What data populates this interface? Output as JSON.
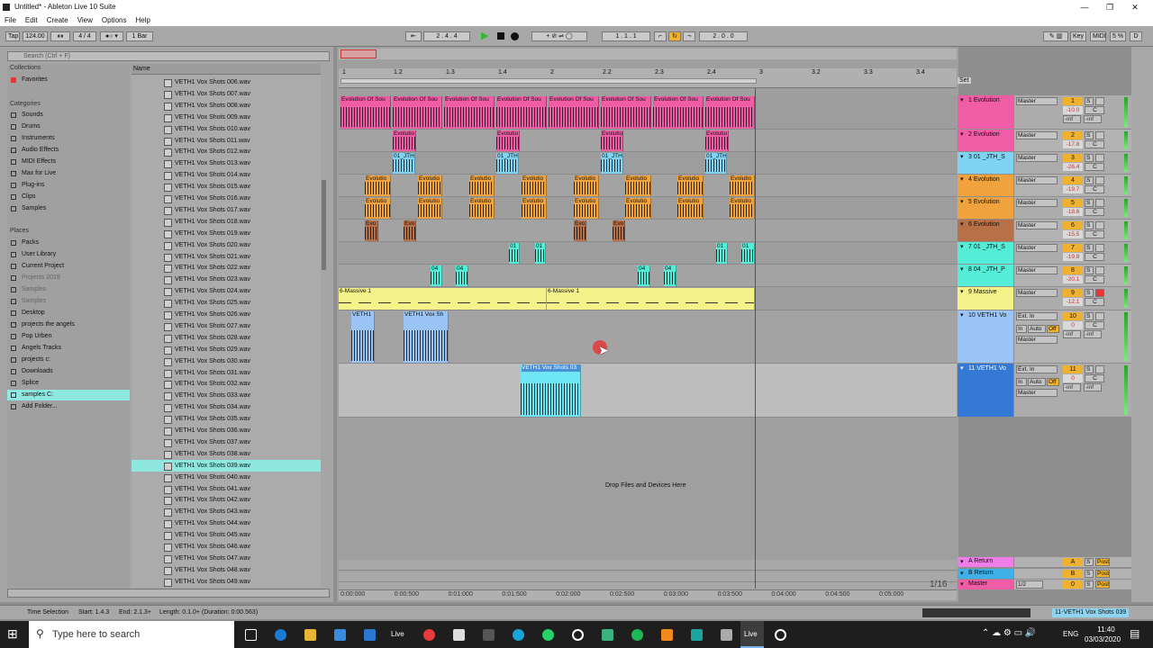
{
  "window": {
    "title": "Untitled* - Ableton Live 10 Suite",
    "controls": [
      "—",
      "❐",
      "✕"
    ]
  },
  "menu": [
    "File",
    "Edit",
    "Create",
    "View",
    "Options",
    "Help"
  ],
  "transport": {
    "tap": "Tap",
    "tempo": "124.00",
    "signature": "4 / 4",
    "quantize": "1 Bar",
    "arrangement_position": "2 . 4 . 4",
    "loop_start": "1 . 1 . 1",
    "loop_length": "2 . 0 . 0",
    "key": "Key",
    "midi": "MIDI",
    "cpu": "5 %",
    "d": "D"
  },
  "browser": {
    "search_placeholder": "Search (Ctrl + F)",
    "collections_title": "Collections",
    "favorites": "Favorites",
    "categories_title": "Categories",
    "categories": [
      "Sounds",
      "Drums",
      "Instruments",
      "Audio Effects",
      "MIDI Effects",
      "Max for Live",
      "Plug-ins",
      "Clips",
      "Samples"
    ],
    "places_title": "Places",
    "places": [
      "Packs",
      "User Library",
      "Current Project",
      "Projects 2019",
      "Samples",
      "Samples",
      "Desktop",
      "projects the angels",
      "Pop Urben",
      "Angels Tracks",
      "projects c:",
      "Downloads",
      "Splice",
      "samples C:",
      "Add Folder..."
    ],
    "name_header": "Name",
    "files": [
      "VETH1 Vox Shots 006.wav",
      "VETH1 Vox Shots 007.wav",
      "VETH1 Vox Shots 008.wav",
      "VETH1 Vox Shots 009.wav",
      "VETH1 Vox Shots 010.wav",
      "VETH1 Vox Shots 011.wav",
      "VETH1 Vox Shots 012.wav",
      "VETH1 Vox Shots 013.wav",
      "VETH1 Vox Shots 014.wav",
      "VETH1 Vox Shots 015.wav",
      "VETH1 Vox Shots 016.wav",
      "VETH1 Vox Shots 017.wav",
      "VETH1 Vox Shots 018.wav",
      "VETH1 Vox Shots 019.wav",
      "VETH1 Vox Shots 020.wav",
      "VETH1 Vox Shots 021.wav",
      "VETH1 Vox Shots 022.wav",
      "VETH1 Vox Shots 023.wav",
      "VETH1 Vox Shots 024.wav",
      "VETH1 Vox Shots 025.wav",
      "VETH1 Vox Shots 026.wav",
      "VETH1 Vox Shots 027.wav",
      "VETH1 Vox Shots 028.wav",
      "VETH1 Vox Shots 029.wav",
      "VETH1 Vox Shots 030.wav",
      "VETH1 Vox Shots 031.wav",
      "VETH1 Vox Shots 032.wav",
      "VETH1 Vox Shots 033.wav",
      "VETH1 Vox Shots 034.wav",
      "VETH1 Vox Shots 035.wav",
      "VETH1 Vox Shots 036.wav",
      "VETH1 Vox Shots 037.wav",
      "VETH1 Vox Shots 038.wav",
      "VETH1 Vox Shots 039.wav",
      "VETH1 Vox Shots 040.wav",
      "VETH1 Vox Shots 041.wav",
      "VETH1 Vox Shots 042.wav",
      "VETH1 Vox Shots 043.wav",
      "VETH1 Vox Shots 044.wav",
      "VETH1 Vox Shots 045.wav",
      "VETH1 Vox Shots 046.wav",
      "VETH1 Vox Shots 047.wav",
      "VETH1 Vox Shots 048.wav",
      "VETH1 Vox Shots 049.wav"
    ],
    "selected_file": "VETH1 Vox Shots 039.wav"
  },
  "ruler": {
    "bars": [
      "1",
      "1.2",
      "1.3",
      "1.4",
      "2",
      "2.2",
      "2.3",
      "2.4",
      "3",
      "3.2",
      "3.3",
      "3.4"
    ],
    "times": [
      "0:00:000",
      "0:00:500",
      "0:01:000",
      "0:01:500",
      "0:02:000",
      "0:02:500",
      "0:03:000",
      "0:03:500",
      "0:04:000",
      "0:04:500",
      "0:05:000"
    ],
    "set": "Set",
    "zoom": "1/16"
  },
  "tracks": [
    {
      "name": "1 Evolution",
      "num": "1",
      "vol": "-10.0",
      "pan": "C",
      "route": "Master",
      "color": "#f05ca5"
    },
    {
      "name": "2 Evolution",
      "num": "2",
      "vol": "-17.8",
      "pan": "C",
      "route": "Master",
      "color": "#f05ca5"
    },
    {
      "name": "3 01 _JTH_S",
      "num": "3",
      "vol": "-26.4",
      "pan": "C",
      "route": "Master",
      "color": "#7fd4f4"
    },
    {
      "name": "4 Evolution",
      "num": "4",
      "vol": "-19.7",
      "pan": "C",
      "route": "Master",
      "color": "#f0a23c"
    },
    {
      "name": "5 Evolution",
      "num": "5",
      "vol": "-18.6",
      "pan": "C",
      "route": "Master",
      "color": "#f0a23c"
    },
    {
      "name": "6 Evolution",
      "num": "6",
      "vol": "-15.5",
      "pan": "C",
      "route": "Master",
      "color": "#b77048"
    },
    {
      "name": "7 01 _JTH_S",
      "num": "7",
      "vol": "-19.8",
      "pan": "C",
      "route": "Master",
      "color": "#54eed8"
    },
    {
      "name": "8 04 _JTH_P",
      "num": "8",
      "vol": "-20.1",
      "pan": "C",
      "route": "Master",
      "color": "#54eed8"
    },
    {
      "name": "9 Massive",
      "num": "9",
      "vol": "-12.1",
      "pan": "C",
      "route": "Master",
      "color": "#f5f28a"
    },
    {
      "name": "10 VETH1 Vo",
      "num": "10",
      "vol": "0",
      "pan": "C",
      "route": "Ext. In",
      "color": "#9ac4f5"
    },
    {
      "name": "11 VETH1 Vo",
      "num": "11",
      "vol": "0",
      "pan": "C",
      "route": "Ext. In",
      "color": "#3579d6"
    }
  ],
  "clips": {
    "evolution": "Evolution Of Sou",
    "evolutio": "Evolutio",
    "evo": "Evo",
    "jth01": "01_JTH",
    "c01": "01",
    "c04": "04",
    "massive": "6-Massive 1",
    "veth": "VETH1",
    "veth_vox_sh": "VETH1 Vox Sh",
    "veth_vox_03": "VETH1 Vox Shots 03"
  },
  "io": {
    "master": "Master",
    "in": "In",
    "auto": "Auto",
    "off": "Off",
    "inf": "-inf",
    "c": "C",
    "s": "S",
    "post": "Post",
    "half": "1/2"
  },
  "drop_hint": "Drop Files and Devices Here",
  "returns": [
    {
      "name": "A Return",
      "num": "A",
      "vol": "0",
      "pan": "C",
      "color": "#f07ee8"
    },
    {
      "name": "B Return",
      "num": "B",
      "vol": "0",
      "pan": "C",
      "color": "#3fb0e8"
    },
    {
      "name": "Master",
      "num": "0",
      "vol": "0",
      "pan": "C",
      "color": "#f05ca5"
    }
  ],
  "status": {
    "mode": "Time Selection",
    "start": "Start: 1.4.3",
    "end": "End: 2.1.3+",
    "length": "Length: 0.1.0+ (Duration: 0:00.563)",
    "clip": "11-VETH1 Vox Shots 039"
  },
  "taskbar": {
    "search_placeholder": "Type here to search",
    "lang": "ENG",
    "time": "11:40",
    "date": "03/03/2020",
    "live": "Live"
  }
}
